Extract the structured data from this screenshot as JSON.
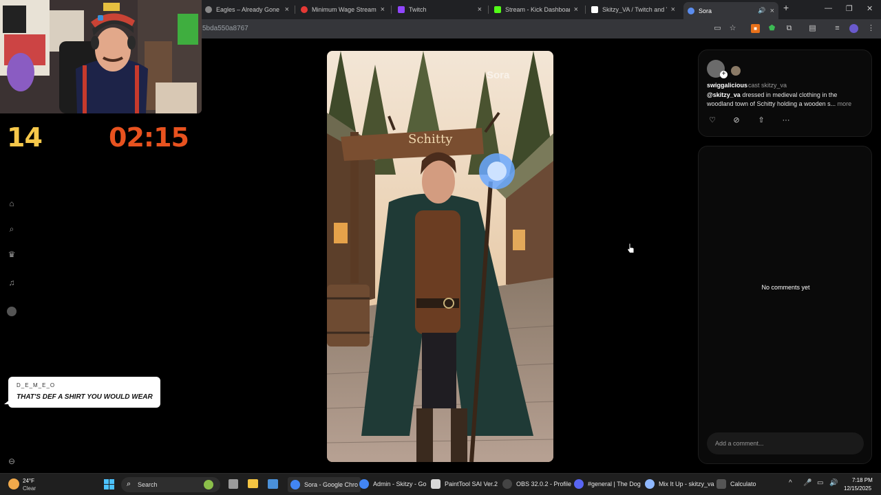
{
  "browser": {
    "tabs": [
      {
        "title": "Eagles – Already Gone Lyr",
        "favicon_color": "#888888"
      },
      {
        "title": "Minimum Wage Stream! $",
        "favicon_color": "#e53935"
      },
      {
        "title": "Twitch",
        "favicon_color": "#9146ff"
      },
      {
        "title": "Stream - Kick Dashboard",
        "favicon_color": "#53fc18"
      },
      {
        "title": "Skitzy_VA / Twitch and Yo",
        "favicon_color": "#ffffff"
      },
      {
        "title": "Sora",
        "favicon_color": "#5b8def"
      }
    ],
    "url": "5bda550a8767",
    "new_tab_icon": "plus-icon"
  },
  "stream_overlay": {
    "counter": "14",
    "timer": "02:15",
    "chat": {
      "user": "D_E_M_E_O",
      "message": "THAT'S DEF A SHIRT YOU WOULD WEAR"
    }
  },
  "video": {
    "sign_text": "Schitty",
    "watermark": "Sora"
  },
  "post": {
    "username": "swiggalicious",
    "cast_label": "cast skitzy_va",
    "caption_mention": "@skitzy_va",
    "caption_text": " dressed in medieval clothing in the woodland town of Schitty holding a wooden s...",
    "more_label": "more",
    "actions": [
      "heart-icon",
      "remix-icon",
      "share-icon",
      "more-icon"
    ]
  },
  "comments": {
    "empty_text": "No comments yet",
    "placeholder": "Add a comment..."
  },
  "taskbar": {
    "weather_temp": "24°F",
    "weather_desc": "Clear",
    "search_label": "Search",
    "apps": [
      {
        "label": "Sora - Google Chro",
        "color": "#4285f4"
      },
      {
        "label": "Admin - Skitzy - Go",
        "color": "#4285f4"
      },
      {
        "label": "PaintTool SAI Ver.2",
        "color": "#d9d9d9"
      },
      {
        "label": "OBS 32.0.2 - Profile",
        "color": "#444444"
      },
      {
        "label": "#general | The Dog",
        "color": "#5865f2"
      },
      {
        "label": "Mix It Up - skitzy_va",
        "color": "#8fb8ff"
      },
      {
        "label": "Calculato",
        "color": "#555555"
      }
    ],
    "time": "7:18 PM",
    "date": "12/15/2025"
  },
  "colors": {
    "counter": "#f6c84a",
    "timer": "#e8521f",
    "accent": "#5b8def"
  }
}
